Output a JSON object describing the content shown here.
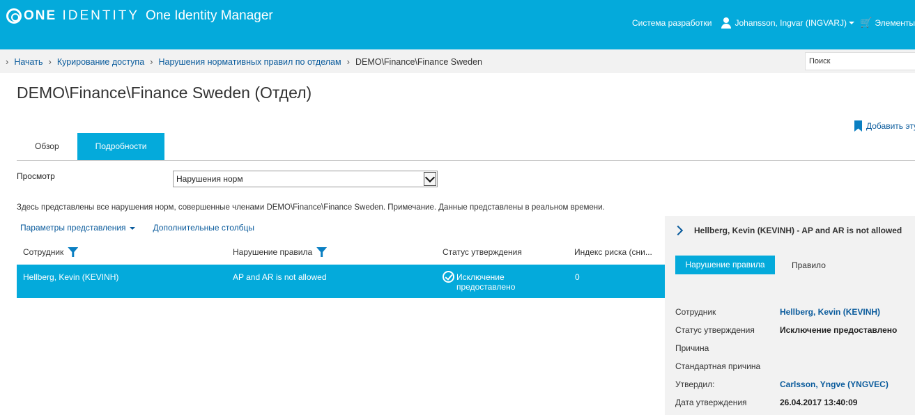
{
  "header": {
    "logo_bold": "ONE",
    "logo_rest": "IDENTITY",
    "app_name": "One Identity Manager",
    "system": "Система разработки",
    "user": "Johansson, Ingvar (INGVARJ)",
    "cart": "Элементы"
  },
  "breadcrumb": {
    "items": [
      "Начать",
      "Курирование доступа",
      "Нарушения нормативных правил по отделам"
    ],
    "current": "DEMO\\Finance\\Finance Sweden"
  },
  "search": {
    "placeholder": "Поиск"
  },
  "page": {
    "title": "DEMO\\Finance\\Finance Sweden (Отдел)",
    "add_link": "Добавить эту"
  },
  "tabs": [
    {
      "label": "Обзор",
      "active": false
    },
    {
      "label": "Подробности",
      "active": true
    }
  ],
  "view": {
    "label": "Просмотр",
    "selected": "Нарушения норм"
  },
  "description": "Здесь представлены все нарушения норм, совершенные членами DEMO\\Finance\\Finance Sweden. Примечание. Данные представлены в реальном времени.",
  "options": {
    "view_params": "Параметры представления",
    "extra_columns": "Дополнительные столбцы"
  },
  "table": {
    "columns": [
      "Сотрудник",
      "Нарушение правила",
      "Статус утверждения",
      "Индекс риска (сни..."
    ],
    "rows": [
      {
        "employee": "Hellberg, Kevin (KEVINH)",
        "violation": "AP and AR is not allowed",
        "status_line1": "Исключение",
        "status_line2": "предоставлено",
        "risk": "0"
      }
    ]
  },
  "panel": {
    "title": "Hellberg, Kevin (KEVINH) - AP and AR is not allowed",
    "tab_active": "Нарушение правила",
    "tab_other": "Правило",
    "props": [
      {
        "label": "Сотрудник",
        "value": "Hellberg, Kevin (KEVINH)",
        "link": true
      },
      {
        "label": "Статус утверждения",
        "value": "Исключение предоставлено",
        "link": false
      },
      {
        "label": "Причина",
        "value": "",
        "link": false
      },
      {
        "label": "Стандартная причина",
        "value": "",
        "link": false
      },
      {
        "label": "Утвердил:",
        "value": "Carlsson, Yngve (YNGVEC)",
        "link": true
      },
      {
        "label": "Дата утверждения",
        "value": "26.04.2017 13:40:09",
        "link": false
      }
    ]
  },
  "colors": {
    "accent": "#04aadb",
    "link": "#0a5b9c"
  }
}
